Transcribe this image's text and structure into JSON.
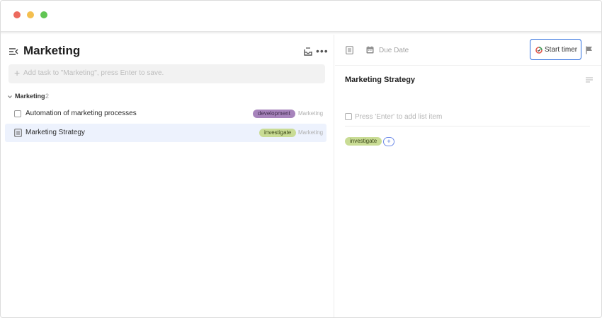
{
  "window": {
    "controls": [
      "close",
      "minimize",
      "maximize"
    ]
  },
  "list": {
    "title": "Marketing",
    "add_task_placeholder": "Add task to \"Marketing\", press Enter to save.",
    "header_icons": [
      "inbox-icon",
      "more-icon"
    ],
    "section": {
      "name": "Marketing",
      "count": "2"
    },
    "tasks": [
      {
        "title": "Automation of marketing processes",
        "tag": "development",
        "tag_color": "#a784bc",
        "list": "Marketing",
        "selected": false,
        "icon": "checkbox"
      },
      {
        "title": "Marketing Strategy",
        "tag": "investigate",
        "tag_color": "#c9dc95",
        "list": "Marketing",
        "selected": true,
        "icon": "note"
      }
    ]
  },
  "detail": {
    "due_date_label": "Due Date",
    "start_timer_label": "Start timer",
    "title": "Marketing Strategy",
    "checklist_placeholder": "Press 'Enter' to add list item",
    "tags": [
      "investigate"
    ],
    "add_tag_symbol": "+"
  },
  "colors": {
    "accent": "#2f6fde",
    "selected_row": "#edf2fd"
  }
}
